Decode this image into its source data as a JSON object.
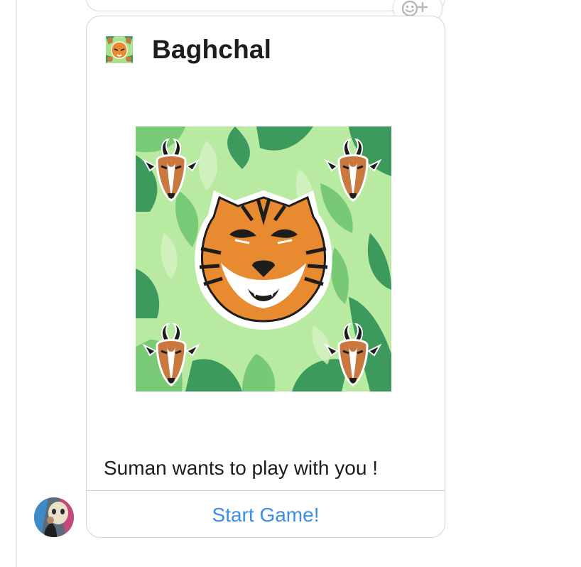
{
  "message": {
    "app_name": "Baghchal",
    "invite_text": "Suman wants to play with you !",
    "start_button_label": "Start Game!"
  },
  "icons": {
    "reaction": "add-reaction-icon",
    "app": "tiger-app-icon",
    "artwork": "tiger-and-goats-artwork",
    "avatar": "user-avatar"
  },
  "colors": {
    "link_blue": "#3a8ee6",
    "jungle_light": "#a8e392",
    "jungle_dark": "#3c9a5c",
    "tiger_orange": "#e88a2f",
    "goat_brown": "#c9793f"
  }
}
